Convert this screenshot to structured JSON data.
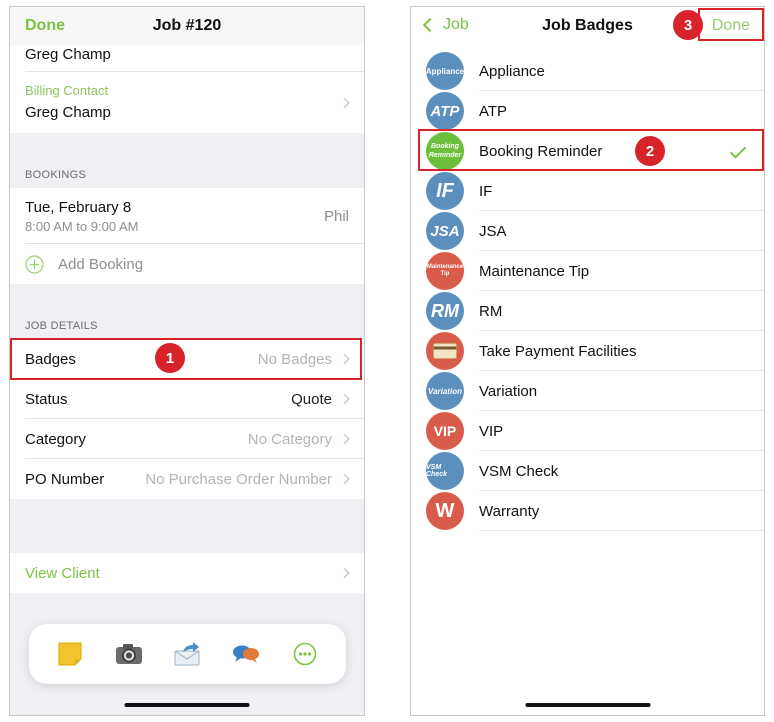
{
  "left": {
    "nav": {
      "left": "Done",
      "title": "Job #120"
    },
    "top_name": "Greg Champ",
    "billing": {
      "label": "Billing Contact",
      "name": "Greg Champ"
    },
    "bookings": {
      "header": "BOOKINGS",
      "date": "Tue, February 8",
      "time": "8:00 AM to 9:00 AM",
      "person": "Phil",
      "add": "Add Booking"
    },
    "details": {
      "header": "JOB DETAILS",
      "rows": [
        {
          "label": "Badges",
          "value": "No Badges"
        },
        {
          "label": "Status",
          "value": "Quote"
        },
        {
          "label": "Category",
          "value": "No Category"
        },
        {
          "label": "PO Number",
          "value": "No Purchase Order Number"
        }
      ]
    },
    "view_client": "View Client",
    "toolbar": [
      "note-icon",
      "camera-icon",
      "share-icon",
      "chat-icon",
      "more-icon"
    ]
  },
  "right": {
    "nav": {
      "back": "Job",
      "title": "Job Badges",
      "done": "Done"
    },
    "badges": [
      {
        "label": "Appliance",
        "avatar": "Appliance",
        "color": "#5b8fbd"
      },
      {
        "label": "ATP",
        "avatar": "ATP",
        "color": "#5b8fbd"
      },
      {
        "label": "Booking Reminder",
        "avatar": "Booking Reminder",
        "color": "#6bbf3a",
        "selected": true
      },
      {
        "label": "IF",
        "avatar": "IF",
        "color": "#5b8fbd"
      },
      {
        "label": "JSA",
        "avatar": "JSA",
        "color": "#5b8fbd"
      },
      {
        "label": "Maintenance Tip",
        "avatar": "Maintenance Tip",
        "color": "#d95b4a"
      },
      {
        "label": "RM",
        "avatar": "RM",
        "color": "#5b8fbd"
      },
      {
        "label": "Take Payment Facilities",
        "avatar": "",
        "color": "#d95b4a"
      },
      {
        "label": "Variation",
        "avatar": "Variation",
        "color": "#5b8fbd"
      },
      {
        "label": "VIP",
        "avatar": "VIP",
        "color": "#d95b4a"
      },
      {
        "label": "VSM Check",
        "avatar": "VSM Check",
        "color": "#5b8fbd"
      },
      {
        "label": "Warranty",
        "avatar": "W",
        "color": "#d95b4a"
      }
    ]
  },
  "callouts": [
    "1",
    "2",
    "3"
  ],
  "colors": {
    "accent": "#7dc242",
    "highlight": "#d8232a"
  }
}
